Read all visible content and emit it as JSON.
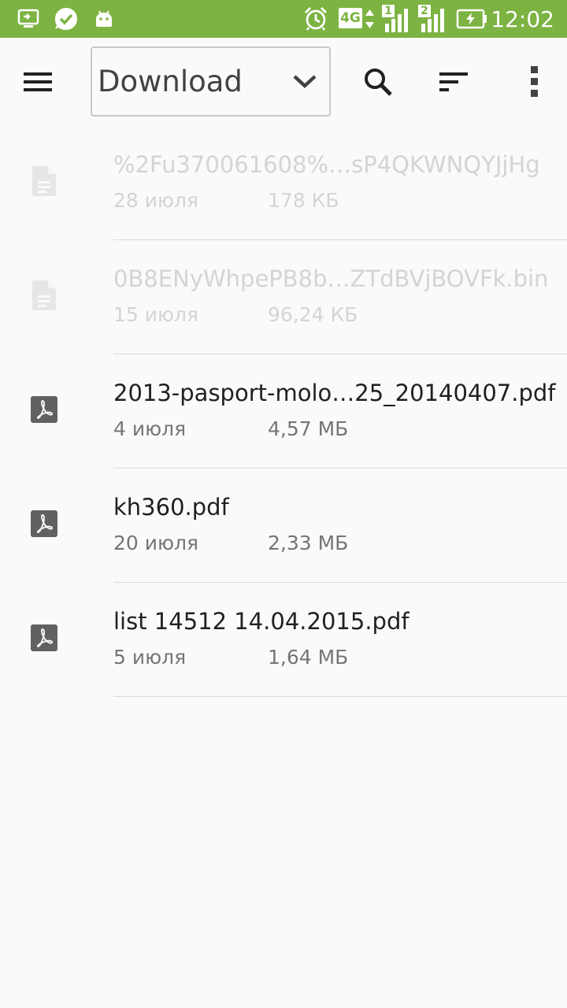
{
  "status_bar": {
    "time": "12:02",
    "network_type": "4G",
    "sim1_label": "1",
    "sim2_label": "2",
    "background_color": "#7cb342",
    "icons": [
      "screen-cast-icon",
      "check-circle-icon",
      "android-icon",
      "alarm-icon",
      "4g-icon",
      "signal-sim1-icon",
      "signal-sim2-icon",
      "battery-charging-icon"
    ]
  },
  "toolbar": {
    "folder_label": "Download",
    "icons": [
      "menu-icon",
      "chevron-down-icon",
      "search-icon",
      "sort-icon",
      "more-vert-icon"
    ]
  },
  "files": [
    {
      "name": "%2Fu370061608%…sP4QKWNQYJjHg",
      "date": "28 июля",
      "size": "178 КБ",
      "icon": "document-icon",
      "disabled": true
    },
    {
      "name": "0B8ENyWhpePB8b…ZTdBVjBOVFk.bin",
      "date": "15 июля",
      "size": "96,24 КБ",
      "icon": "document-icon",
      "disabled": true
    },
    {
      "name": "2013-pasport-molo…25_20140407.pdf",
      "date": "4 июля",
      "size": "4,57 МБ",
      "icon": "pdf-icon",
      "disabled": false
    },
    {
      "name": "kh360.pdf",
      "date": "20 июля",
      "size": "2,33 МБ",
      "icon": "pdf-icon",
      "disabled": false
    },
    {
      "name": "list 14512 14.04.2015.pdf",
      "date": "5 июля",
      "size": "1,64 МБ",
      "icon": "pdf-icon",
      "disabled": false
    }
  ]
}
